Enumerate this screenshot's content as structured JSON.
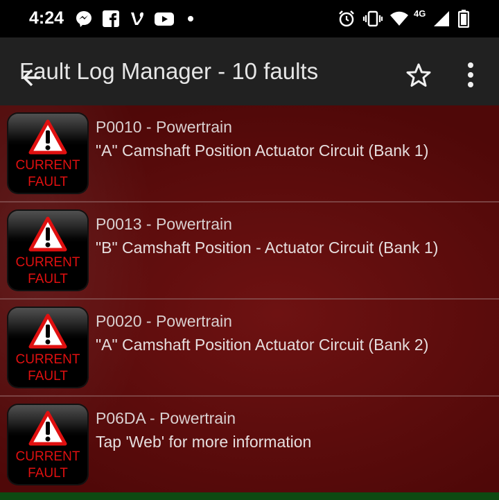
{
  "status_bar": {
    "time": "4:24",
    "left_icons": [
      "messenger-icon",
      "facebook-icon",
      "vine-icon",
      "youtube-icon",
      "dot-icon"
    ],
    "right_icons": [
      "alarm-icon",
      "vibrate-icon",
      "wifi-icon",
      "network-4g-icon",
      "signal-icon",
      "battery-icon"
    ],
    "network_label": "4G"
  },
  "app_bar": {
    "title": "Fault Log Manager - 10 faults",
    "icons": [
      "back-arrow-icon",
      "star-icon",
      "overflow-menu-icon"
    ]
  },
  "faults": [
    {
      "badge_line1": "CURRENT",
      "badge_line2": "FAULT",
      "code": "P0010 - Powertrain",
      "description": "\"A\" Camshaft Position Actuator Circuit (Bank 1)"
    },
    {
      "badge_line1": "CURRENT",
      "badge_line2": "FAULT",
      "code": "P0013 - Powertrain",
      "description": "\"B\" Camshaft Position - Actuator Circuit (Bank 1)"
    },
    {
      "badge_line1": "CURRENT",
      "badge_line2": "FAULT",
      "code": "P0020 - Powertrain",
      "description": "\"A\" Camshaft Position Actuator Circuit (Bank 2)"
    },
    {
      "badge_line1": "CURRENT",
      "badge_line2": "FAULT",
      "code": "P06DA - Powertrain",
      "description": "Tap 'Web' for more information"
    }
  ],
  "colors": {
    "app_bar": "#212121",
    "list_background": "#5e0c0c",
    "badge_text": "#e01010",
    "warning_triangle": "#e01010"
  }
}
